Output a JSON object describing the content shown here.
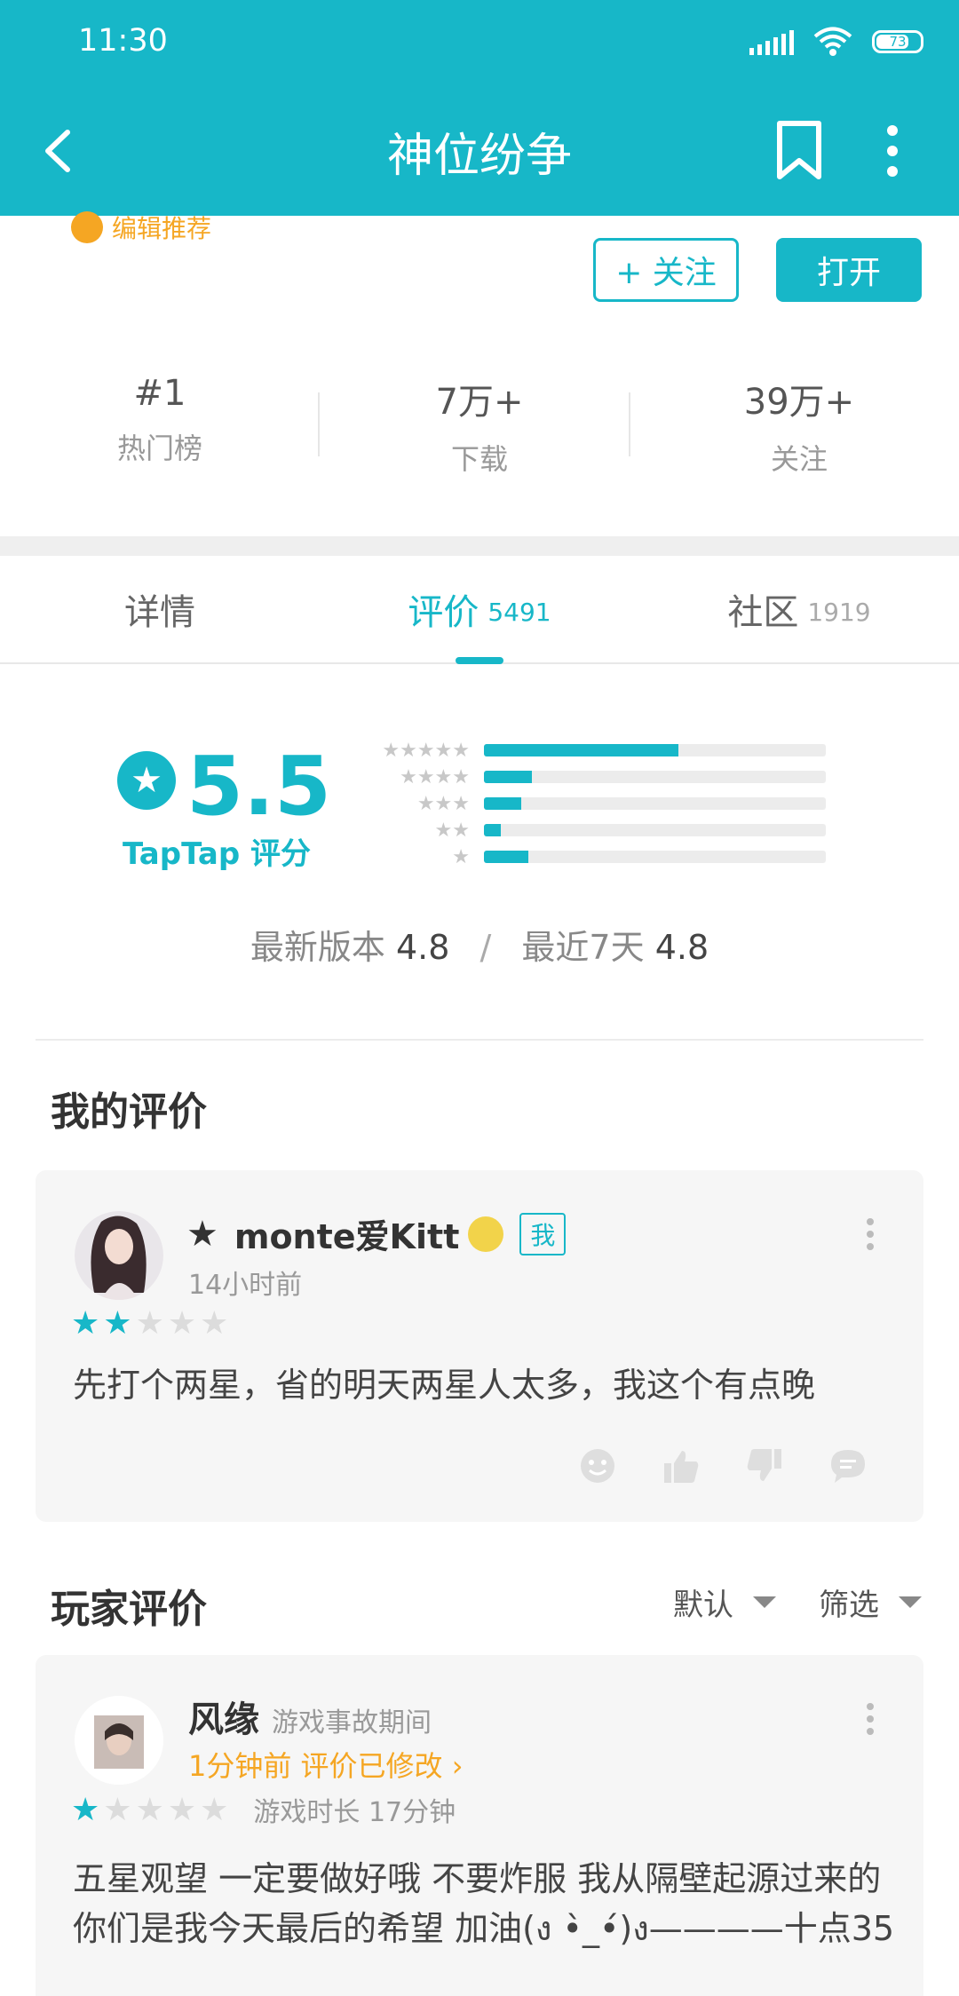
{
  "status_bar": {
    "time": "11:30",
    "battery": "73"
  },
  "app_bar": {
    "title": "神位纷争"
  },
  "header": {
    "editor_pick": "编辑推荐",
    "follow_label": "+ 关注",
    "open_label": "打开"
  },
  "stats": [
    {
      "value": "#1",
      "label": "热门榜"
    },
    {
      "value": "7万+",
      "label": "下载"
    },
    {
      "value": "39万+",
      "label": "关注"
    }
  ],
  "tabs": [
    {
      "label": "详情",
      "count": ""
    },
    {
      "label": "评价",
      "count": "5491"
    },
    {
      "label": "社区",
      "count": "1919"
    }
  ],
  "rating": {
    "score": "5.5",
    "brand_label": "TapTap 评分",
    "distribution": [
      {
        "stars": 5,
        "fraction": 0.57
      },
      {
        "stars": 4,
        "fraction": 0.14
      },
      {
        "stars": 3,
        "fraction": 0.11
      },
      {
        "stars": 2,
        "fraction": 0.05
      },
      {
        "stars": 1,
        "fraction": 0.13
      }
    ],
    "latest_version_label": "最新版本",
    "latest_version_score": "4.8",
    "recent_label": "最近7天",
    "recent_score": "4.8",
    "separator": "/"
  },
  "my_review": {
    "section_title": "我的评价",
    "user_prefix": "★",
    "username": "monte爱Kitt",
    "me_badge": "我",
    "time": "14小时前",
    "stars": 2,
    "text": "先打个两星，省的明天两星人太多，我这个有点晚"
  },
  "player_reviews": {
    "section_title": "玩家评价",
    "sort_label": "默认",
    "filter_label": "筛选",
    "items": [
      {
        "username": "风缘",
        "tag": "游戏事故期间",
        "time_modified": "1分钟前 评价已修改 ›",
        "stars": 1,
        "playtime": "游戏时长 17分钟",
        "text": "五星观望 一定要做好哦 不要炸服 我从隔壁起源过来的 你们是我今天最后的希望 加油(ง •̀_•́)ง————十点35"
      }
    ]
  },
  "colors": {
    "accent": "#17b7c8",
    "orange": "#f5a623"
  }
}
